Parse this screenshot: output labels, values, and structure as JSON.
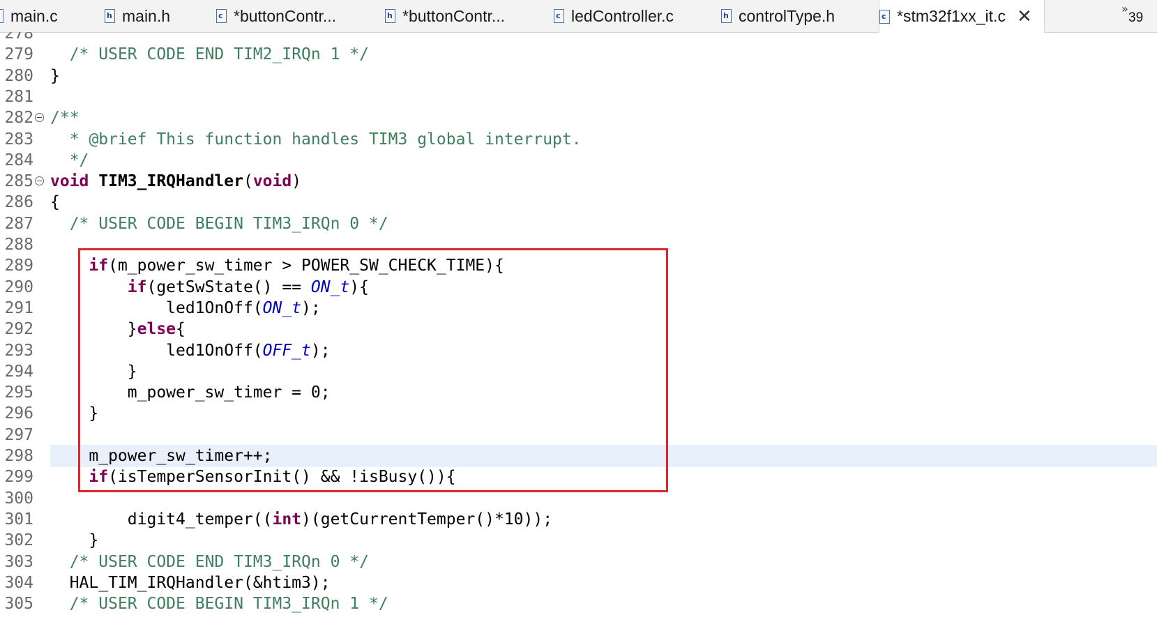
{
  "tabs": [
    {
      "label": "main.c",
      "icon": "c-file-icon",
      "badge": "c",
      "active": false
    },
    {
      "label": "main.h",
      "icon": "h-file-icon",
      "badge": "h",
      "active": false
    },
    {
      "label": "*buttonContr...",
      "icon": "c-file-icon",
      "badge": "c",
      "active": false
    },
    {
      "label": "*buttonContr...",
      "icon": "h-file-icon",
      "badge": "h",
      "active": false
    },
    {
      "label": "ledController.c",
      "icon": "c-file-icon",
      "badge": "c",
      "active": false
    },
    {
      "label": "controlType.h",
      "icon": "h-file-icon",
      "badge": "h",
      "active": false
    },
    {
      "label": "*stm32f1xx_it.c",
      "icon": "c-file-icon",
      "badge": "c",
      "active": true,
      "close": "✕"
    }
  ],
  "overflow": {
    "chevron": "»",
    "count": "39"
  },
  "editor": {
    "lines": [
      {
        "no": "278",
        "tokens": [
          [
            "",
            ""
          ]
        ]
      },
      {
        "no": "279",
        "tokens": [
          [
            "  ",
            ""
          ],
          [
            "/* USER CODE END TIM2_IRQn 1 */",
            "cm"
          ]
        ]
      },
      {
        "no": "280",
        "tokens": [
          [
            "}",
            ""
          ]
        ]
      },
      {
        "no": "281",
        "tokens": [
          [
            "",
            ""
          ]
        ]
      },
      {
        "no": "282",
        "fold": true,
        "tokens": [
          [
            "/**",
            "cm"
          ]
        ]
      },
      {
        "no": "283",
        "tokens": [
          [
            "  * @brief This function handles TIM3 global interrupt.",
            "cm"
          ]
        ]
      },
      {
        "no": "284",
        "tokens": [
          [
            "  */",
            "cm"
          ]
        ]
      },
      {
        "no": "285",
        "fold": true,
        "tokens": [
          [
            "void",
            "kw"
          ],
          [
            " ",
            ""
          ],
          [
            "TIM3_IRQHandler",
            "fn"
          ],
          [
            "(",
            ""
          ],
          [
            "void",
            "kw"
          ],
          [
            ")",
            ""
          ]
        ]
      },
      {
        "no": "286",
        "tokens": [
          [
            "{",
            ""
          ]
        ]
      },
      {
        "no": "287",
        "tokens": [
          [
            "  ",
            ""
          ],
          [
            "/* USER CODE BEGIN TIM3_IRQn 0 */",
            "cm"
          ]
        ]
      },
      {
        "no": "288",
        "tokens": [
          [
            "",
            ""
          ]
        ]
      },
      {
        "no": "289",
        "tokens": [
          [
            "    ",
            ""
          ],
          [
            "if",
            "kw"
          ],
          [
            "(m_power_sw_timer > POWER_SW_CHECK_TIME){",
            ""
          ]
        ]
      },
      {
        "no": "290",
        "tokens": [
          [
            "        ",
            ""
          ],
          [
            "if",
            "kw"
          ],
          [
            "(getSwState() == ",
            ""
          ],
          [
            "ON_t",
            "en"
          ],
          [
            "){",
            ""
          ]
        ]
      },
      {
        "no": "291",
        "tokens": [
          [
            "            led1OnOff(",
            ""
          ],
          [
            "ON_t",
            "en"
          ],
          [
            ");",
            ""
          ]
        ]
      },
      {
        "no": "292",
        "tokens": [
          [
            "        }",
            ""
          ],
          [
            "else",
            "kw"
          ],
          [
            "{",
            ""
          ]
        ]
      },
      {
        "no": "293",
        "tokens": [
          [
            "            led1OnOff(",
            ""
          ],
          [
            "OFF_t",
            "en"
          ],
          [
            ");",
            ""
          ]
        ]
      },
      {
        "no": "294",
        "tokens": [
          [
            "        }",
            ""
          ]
        ]
      },
      {
        "no": "295",
        "tokens": [
          [
            "        m_power_sw_timer = 0;",
            ""
          ]
        ]
      },
      {
        "no": "296",
        "tokens": [
          [
            "    }",
            ""
          ]
        ]
      },
      {
        "no": "297",
        "tokens": [
          [
            "",
            ""
          ]
        ]
      },
      {
        "no": "298",
        "current": true,
        "tokens": [
          [
            "    m_power_sw_timer++;",
            ""
          ]
        ]
      },
      {
        "no": "299",
        "tokens": [
          [
            "    ",
            ""
          ],
          [
            "if",
            "kw"
          ],
          [
            "(isTemperSensorInit() && !isBusy()){",
            ""
          ]
        ]
      },
      {
        "no": "300",
        "tokens": [
          [
            "",
            ""
          ]
        ]
      },
      {
        "no": "301",
        "tokens": [
          [
            "        digit4_temper((",
            ""
          ],
          [
            "int",
            "kw"
          ],
          [
            ")(getCurrentTemper()*10));",
            ""
          ]
        ]
      },
      {
        "no": "302",
        "tokens": [
          [
            "    }",
            ""
          ]
        ]
      },
      {
        "no": "303",
        "tokens": [
          [
            "  ",
            ""
          ],
          [
            "/* USER CODE END TIM3_IRQn 0 */",
            "cm"
          ]
        ]
      },
      {
        "no": "304",
        "tokens": [
          [
            "  HAL_TIM_IRQHandler(&htim3);",
            ""
          ]
        ]
      },
      {
        "no": "305",
        "tokens": [
          [
            "  ",
            ""
          ],
          [
            "/* USER CODE BEGIN TIM3_IRQn 1 */",
            "cm"
          ]
        ]
      }
    ]
  },
  "colors": {
    "keyword": "#7f0055",
    "comment": "#3f7f5f",
    "enum": "#0000c0",
    "current_line": "#e8f0fb",
    "annotation_box": "#e0262a"
  }
}
